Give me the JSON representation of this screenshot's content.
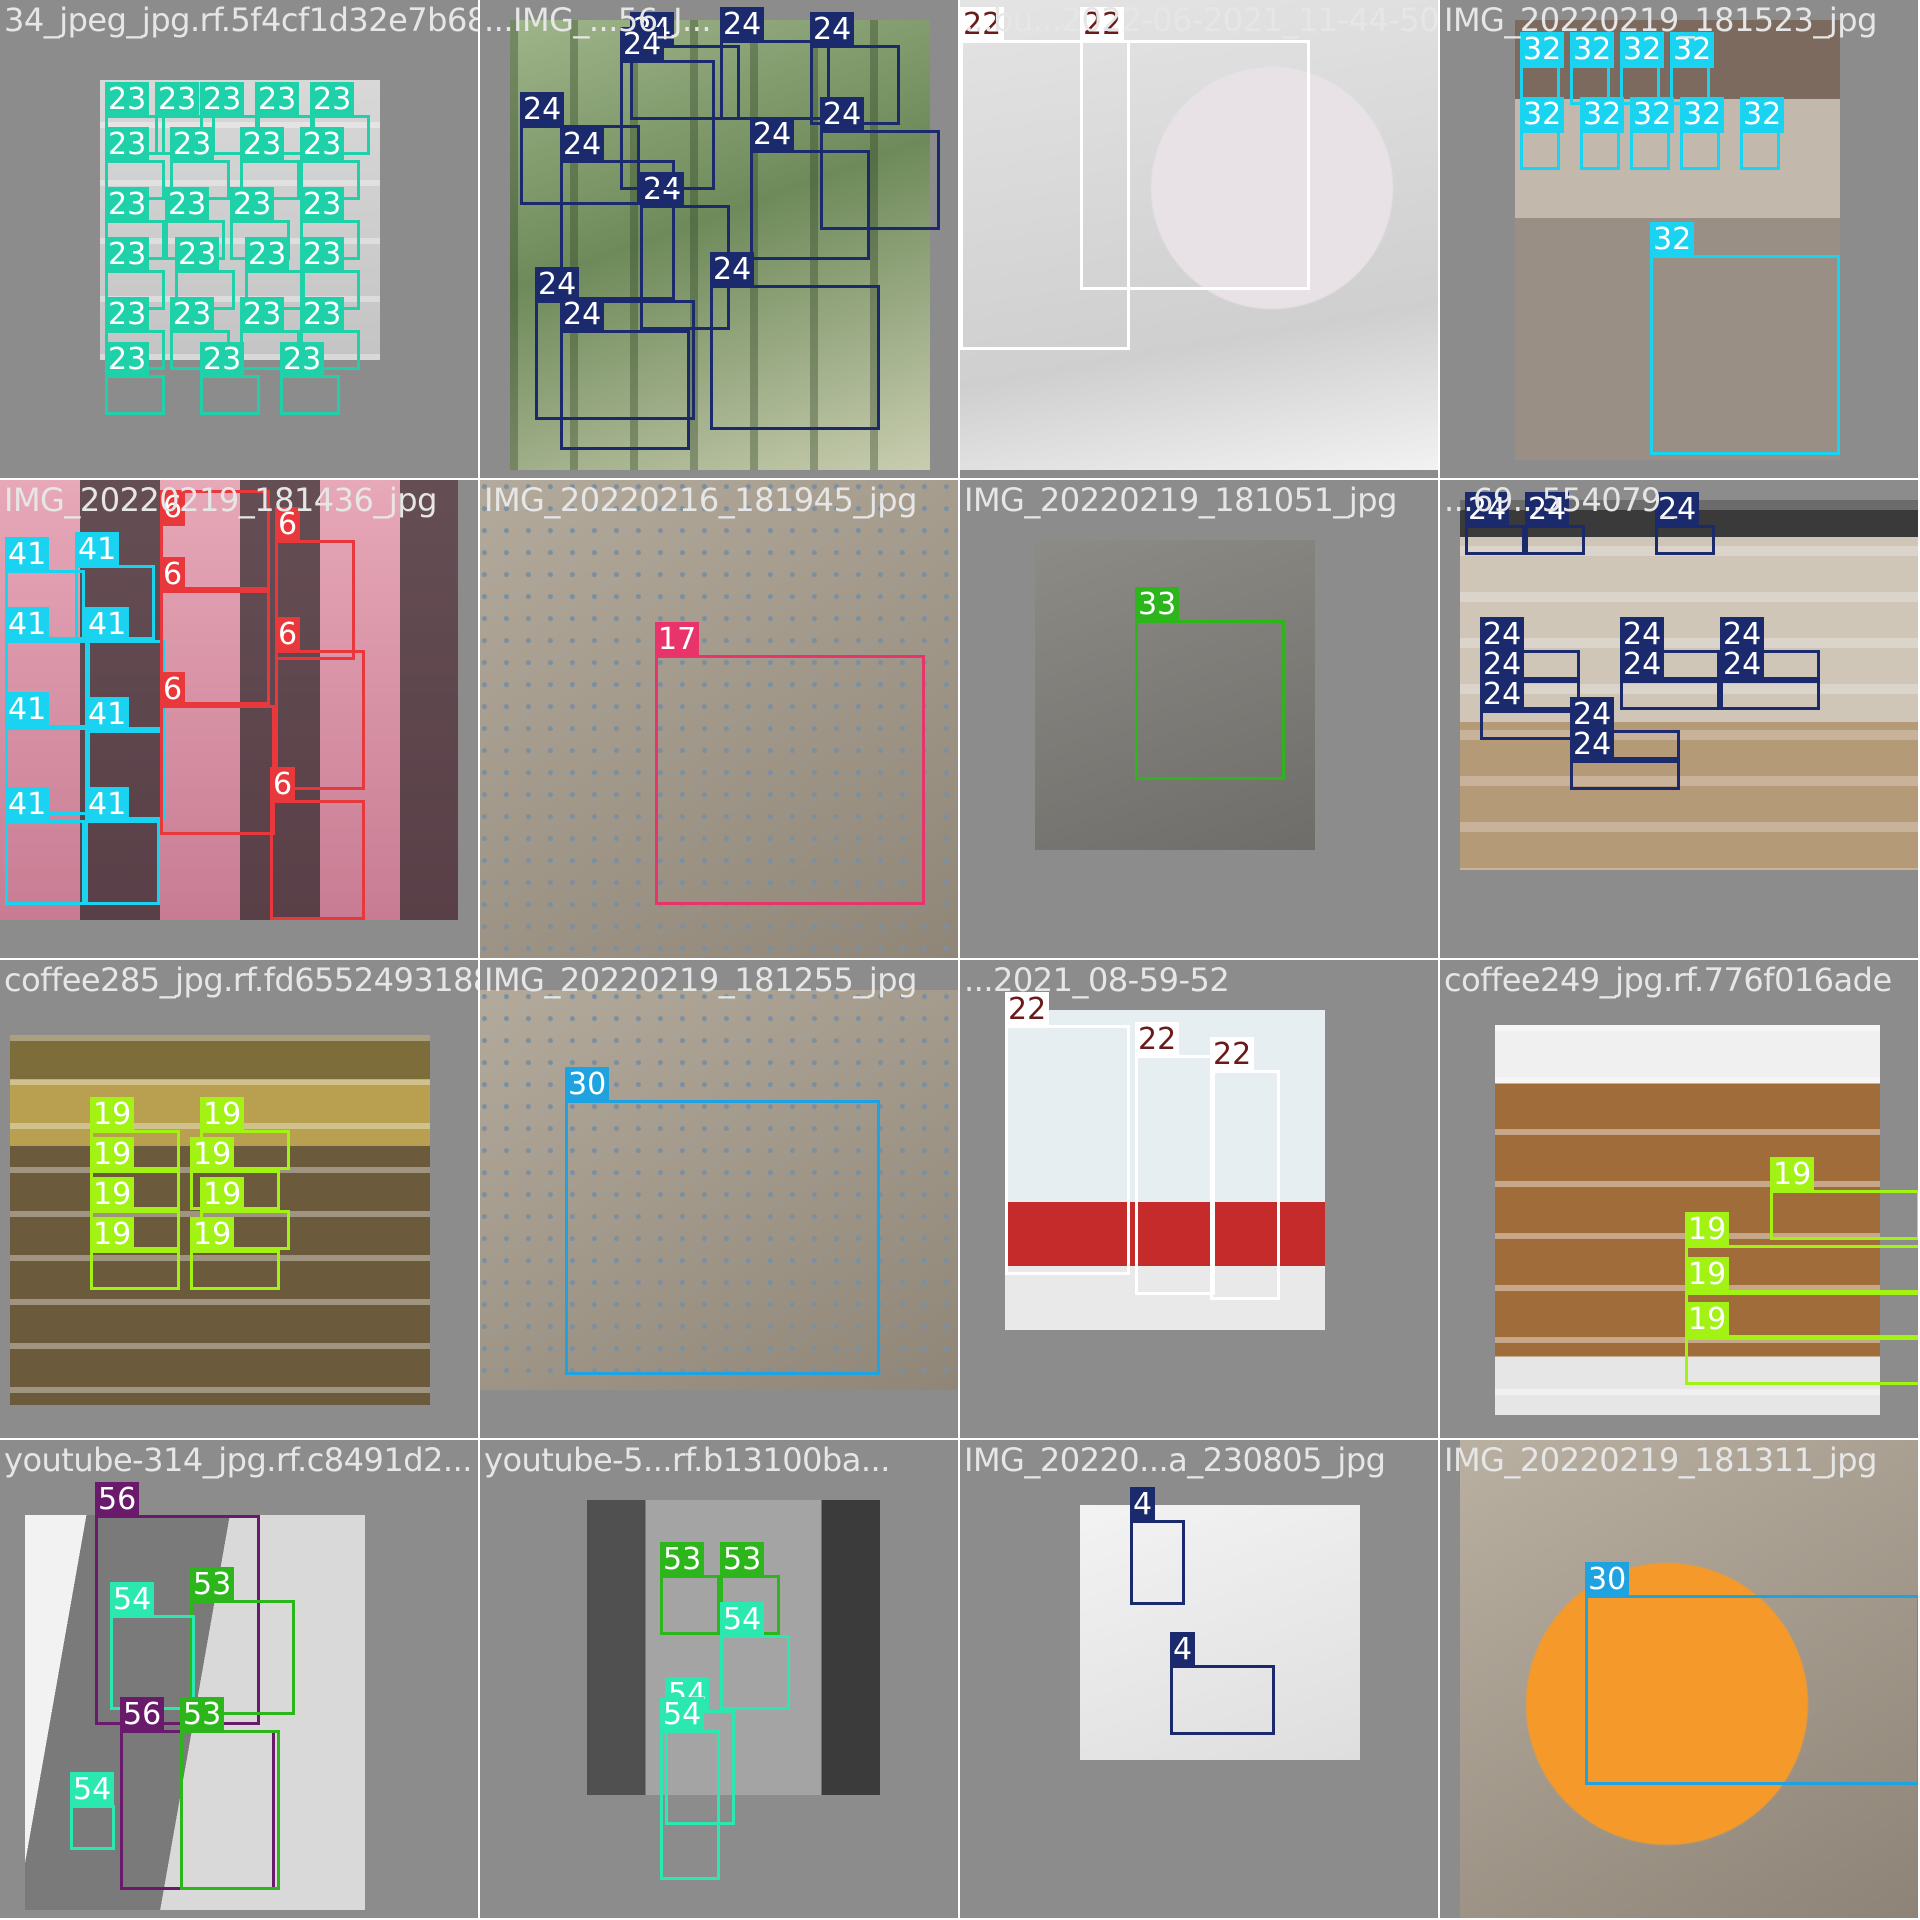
{
  "mosaic": {
    "tiles": [
      {
        "filename": "34_jpeg_jpg.rf.5f4cf1d32e7b68e...",
        "boxes": [
          {
            "label": "23",
            "color": "#1fd1a8",
            "text": "#ffffff"
          }
        ]
      },
      {
        "filename": "...IMG_...56_J...",
        "boxes": [
          {
            "label": "24",
            "color": "#1a2a6c",
            "text": "#ffffff"
          }
        ]
      },
      {
        "filename": "...bu...2022-06-2021_11-44-50",
        "boxes": [
          {
            "label": "22",
            "color": "#ffffff",
            "text": "#6b1a1a"
          }
        ]
      },
      {
        "filename": "IMG_20220219_181523_jpg",
        "boxes": [
          {
            "label": "32",
            "color": "#19d3f0",
            "text": "#ffffff"
          }
        ]
      },
      {
        "filename": "IMG_20220219_181436_jpg",
        "boxes": [
          {
            "label": "41",
            "color": "#19d3f0",
            "text": "#ffffff"
          },
          {
            "label": "6",
            "color": "#e8383b",
            "text": "#ffffff"
          }
        ]
      },
      {
        "filename": "IMG_20220216_181945_jpg",
        "boxes": [
          {
            "label": "17",
            "color": "#e8336b",
            "text": "#ffffff"
          }
        ]
      },
      {
        "filename": "IMG_20220219_181051_jpg",
        "boxes": [
          {
            "label": "33",
            "color": "#2db51c",
            "text": "#ffffff"
          }
        ]
      },
      {
        "filename": "...69...554079_",
        "boxes": [
          {
            "label": "24",
            "color": "#1a2a6c",
            "text": "#ffffff"
          }
        ]
      },
      {
        "filename": "coffee285_jpg.rf.fd6552493188...",
        "boxes": [
          {
            "label": "19",
            "color": "#a2f213",
            "text": "#ffffff"
          }
        ]
      },
      {
        "filename": "IMG_20220219_181255_jpg",
        "boxes": [
          {
            "label": "30",
            "color": "#1fa3e0",
            "text": "#ffffff"
          }
        ]
      },
      {
        "filename": "...2021_08-59-52",
        "boxes": [
          {
            "label": "22",
            "color": "#ffffff",
            "text": "#6b1a1a"
          }
        ]
      },
      {
        "filename": "coffee249_jpg.rf.776f016ade",
        "boxes": [
          {
            "label": "19",
            "color": "#a2f213",
            "text": "#ffffff"
          }
        ]
      },
      {
        "filename": "youtube-314_jpg.rf.c8491d2...",
        "boxes": [
          {
            "label": "56",
            "color": "#6a1a6a",
            "text": "#ffffff"
          },
          {
            "label": "53",
            "color": "#2db51c",
            "text": "#ffffff"
          },
          {
            "label": "54",
            "color": "#2be8b0",
            "text": "#ffffff"
          }
        ]
      },
      {
        "filename": "youtube-5...rf.b13100ba...",
        "boxes": [
          {
            "label": "53",
            "color": "#2db51c",
            "text": "#ffffff"
          },
          {
            "label": "54",
            "color": "#2be8b0",
            "text": "#ffffff"
          }
        ]
      },
      {
        "filename": "IMG_20220...a_230805_jpg",
        "boxes": [
          {
            "label": "4",
            "color": "#1a2a6c",
            "text": "#ffffff"
          }
        ]
      },
      {
        "filename": "IMG_20220219_181311_jpg",
        "boxes": [
          {
            "label": "30",
            "color": "#1fa3e0",
            "text": "#ffffff"
          }
        ]
      }
    ]
  }
}
